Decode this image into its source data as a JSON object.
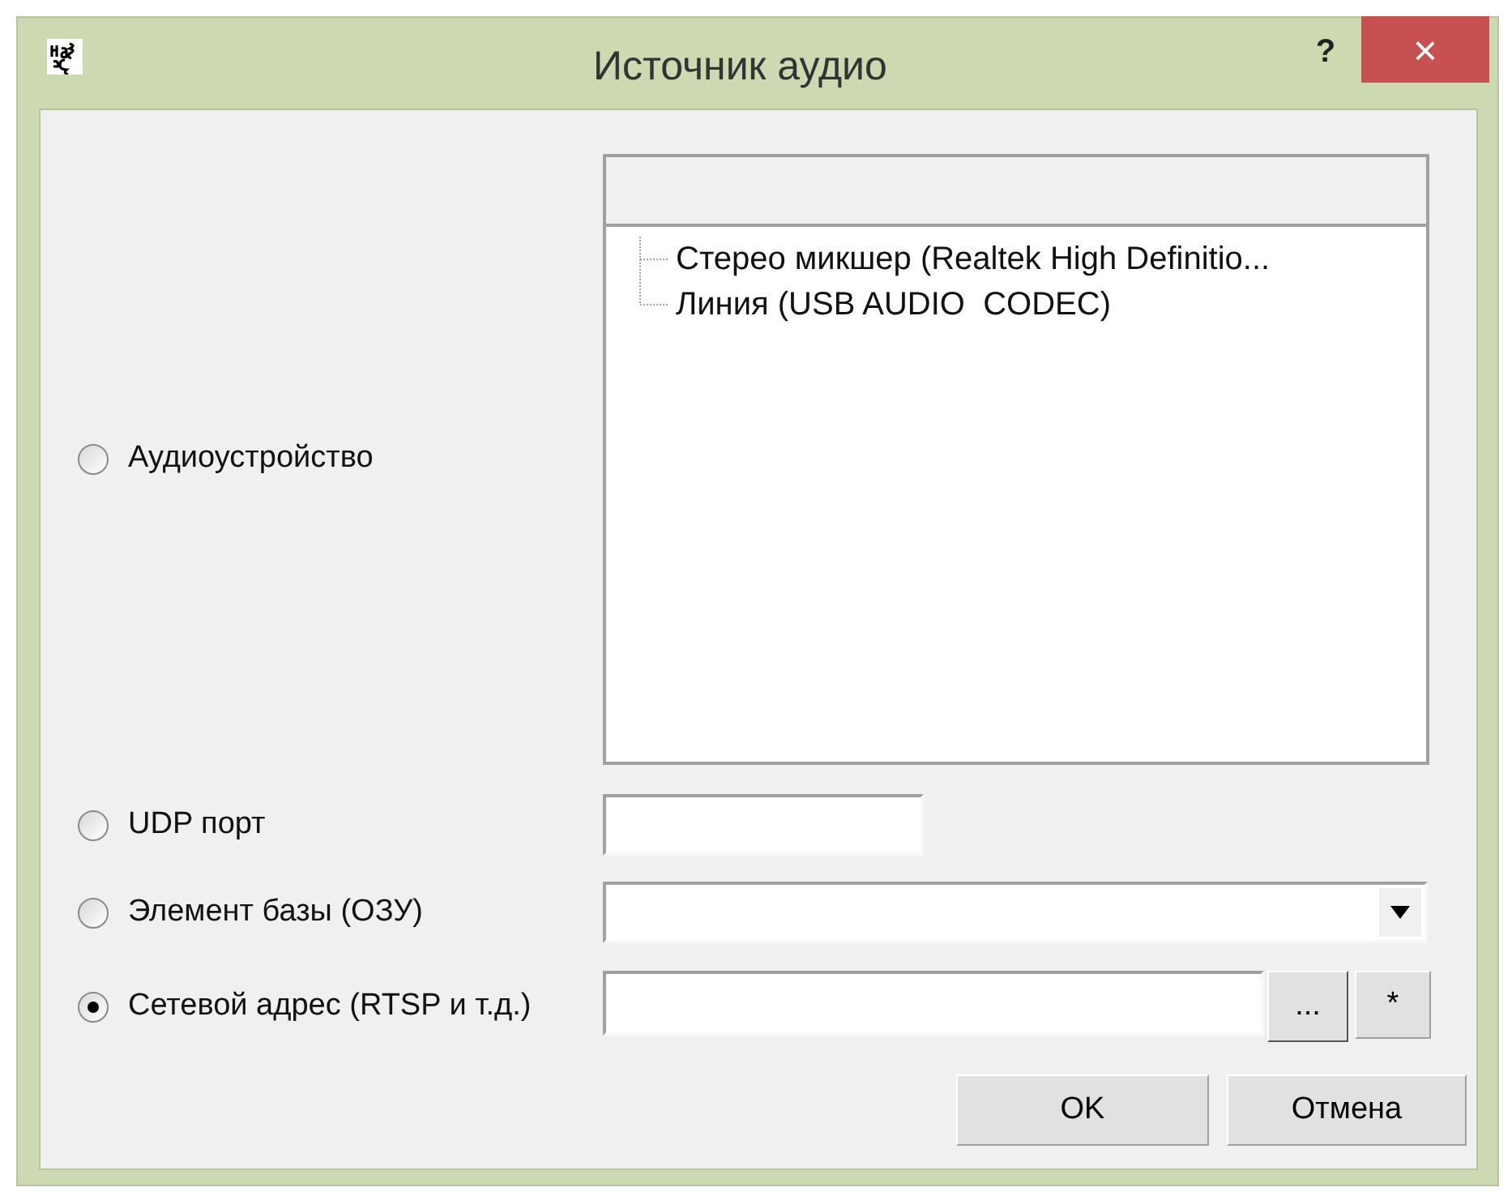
{
  "window": {
    "title": "Источник аудио",
    "help": "?",
    "close": "×"
  },
  "sources": [
    {
      "kind": "device_list",
      "label": "Аудиоустройство",
      "selected": false,
      "devices": [
        "Стерео микшер (Realtek High Definitio...",
        "Линия (USB AUDIO  CODEC)"
      ]
    },
    {
      "kind": "text",
      "label": "UDP порт",
      "selected": false
    },
    {
      "kind": "combo",
      "label": "Элемент базы (ОЗУ)",
      "selected": false
    },
    {
      "kind": "address",
      "label": "Сетевой адрес (RTSP и т.д.)",
      "selected": true,
      "browse": "...",
      "star": "*"
    }
  ],
  "buttons": [
    "OK",
    "Отмена"
  ]
}
